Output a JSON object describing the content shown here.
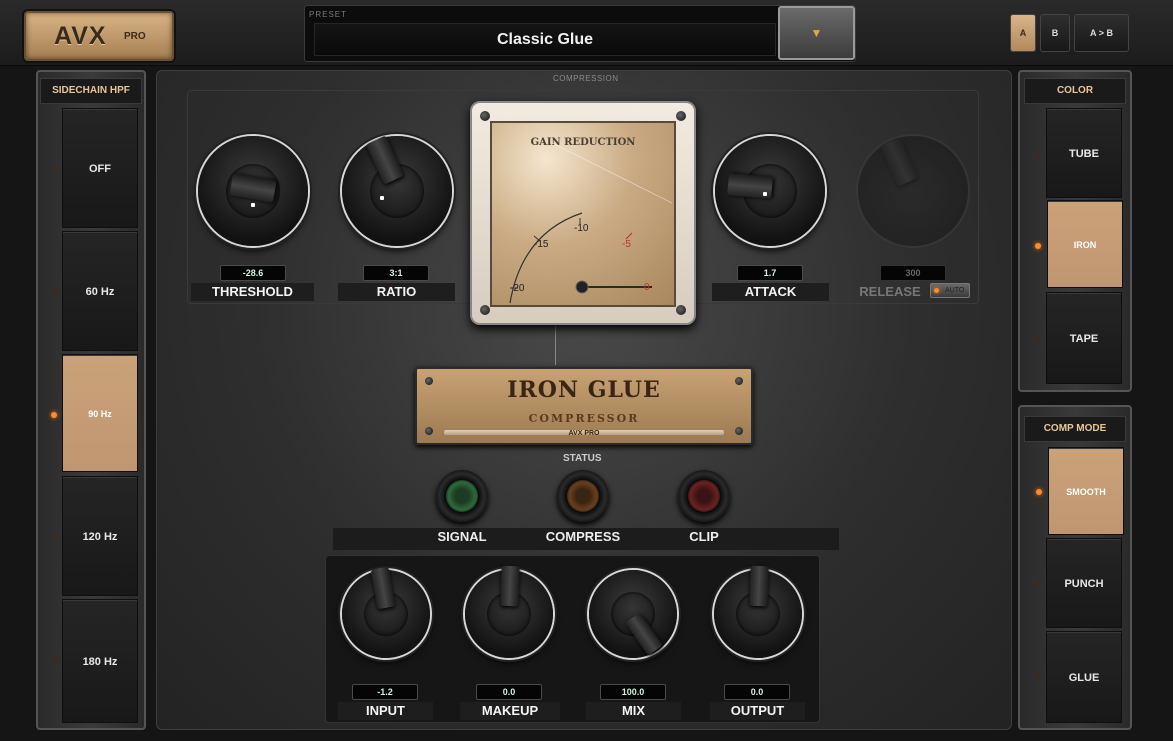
{
  "header": {
    "logo_main": "AVX",
    "logo_sub": "PRO",
    "preset_label": "PRESET",
    "preset_name": "Classic Glue",
    "preset_arrow": "▼",
    "ab_buttons": [
      "A",
      "B",
      "A > B"
    ],
    "ab_active": "A"
  },
  "sidechain": {
    "title": "SIDECHAIN HPF",
    "items": [
      {
        "label": "OFF",
        "active": false
      },
      {
        "label": "60 Hz",
        "active": false
      },
      {
        "label": "90 Hz",
        "active": true
      },
      {
        "label": "120 Hz",
        "active": false
      },
      {
        "label": "180 Hz",
        "active": false
      }
    ]
  },
  "color": {
    "title": "COLOR",
    "items": [
      {
        "label": "TUBE",
        "active": false
      },
      {
        "label": "IRON",
        "active": true
      },
      {
        "label": "TAPE",
        "active": false
      }
    ]
  },
  "comp_mode": {
    "title": "COMP MODE",
    "items": [
      {
        "label": "SMOOTH",
        "active": true
      },
      {
        "label": "PUNCH",
        "active": false
      },
      {
        "label": "GLUE",
        "active": false
      }
    ]
  },
  "compression": {
    "section_label": "COMPRESSION",
    "threshold": {
      "label": "THRESHOLD",
      "value": "-28.6"
    },
    "ratio": {
      "label": "RATIO",
      "value": "3:1"
    },
    "attack": {
      "label": "ATTACK",
      "value": "1.7"
    },
    "release": {
      "label": "RELEASE",
      "value": "300",
      "auto_label": "AUTO"
    }
  },
  "meter": {
    "title": "GAIN REDUCTION",
    "scale": [
      "-20",
      "-15",
      "-10",
      "-5",
      "0"
    ]
  },
  "nameplate": {
    "title": "IRON GLUE",
    "subtitle": "COMPRESSOR",
    "brand": "AVX PRO"
  },
  "status": {
    "label": "STATUS",
    "signal": "SIGNAL",
    "compress": "COMPRESS",
    "clip": "CLIP"
  },
  "io": {
    "input": {
      "label": "INPUT",
      "value": "-1.2"
    },
    "makeup": {
      "label": "MAKEUP",
      "value": "0.0"
    },
    "mix": {
      "label": "MIX",
      "value": "100.0"
    },
    "output": {
      "label": "OUTPUT",
      "value": "0.0"
    }
  }
}
